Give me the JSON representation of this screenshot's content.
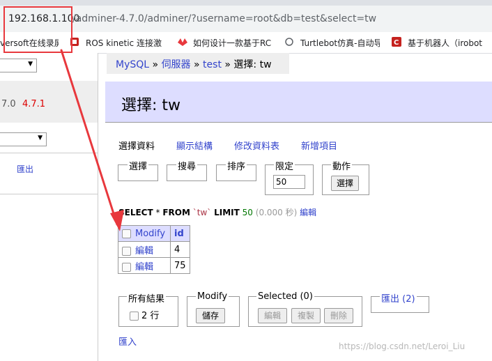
{
  "browser": {
    "url_host": "192.168.1.100",
    "url_path": "/adminer-4.7.0/adminer/?username=root&db=test&select=tw",
    "bookmarks": [
      "versoft在线录屏",
      "ROS kinetic 连接激",
      "如何设计一款基于RC",
      "Turtlebot仿真-自动导",
      "基于机器人（irobot"
    ],
    "bookmark_icon_colors": [
      "#c5221f",
      "#e8383d",
      "#5f6368",
      "#c5221f"
    ]
  },
  "sidebar": {
    "version_current": "7.0",
    "version_new": "4.7.1",
    "export_label": "匯出"
  },
  "breadcrumb": {
    "driver": "MySQL",
    "server": "伺服器",
    "db": "test",
    "current": "選擇: tw",
    "separator": "»"
  },
  "page": {
    "title": "選擇: tw",
    "tabs": [
      "選擇資料",
      "顯示結構",
      "修改資料表",
      "新增項目"
    ]
  },
  "filters": {
    "select_legend": "選擇",
    "search_legend": "搜尋",
    "sort_legend": "排序",
    "limit_legend": "限定",
    "limit_value": "50",
    "action_legend": "動作",
    "select_button": "選擇"
  },
  "query": {
    "keyword_select": "SELECT",
    "star": "*",
    "keyword_from": "FROM",
    "table": "`tw`",
    "keyword_limit": "LIMIT",
    "limit": "50",
    "time": "(0.000 秒)",
    "edit_link": "編輯"
  },
  "table": {
    "headers": [
      "Modify",
      "id"
    ],
    "rows": [
      {
        "action": "編輯",
        "id": "4"
      },
      {
        "action": "編輯",
        "id": "75"
      }
    ]
  },
  "bottom": {
    "all_results_legend": "所有結果",
    "row_count": "2 行",
    "modify_legend": "Modify",
    "save_button": "儲存",
    "selected_legend": "Selected (0)",
    "edit_button": "編輯",
    "clone_button": "複製",
    "delete_button": "刪除",
    "export_link": "匯出 (2)",
    "import_link": "匯入"
  },
  "watermark": "https://blog.csdn.net/Leroi_Liu",
  "colors": {
    "annotation_red": "#e8383d",
    "link_blue": "#3333cc",
    "title_bg": "#ddddff"
  }
}
